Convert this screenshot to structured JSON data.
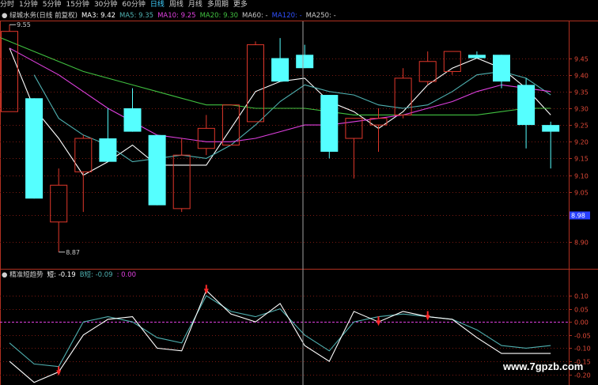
{
  "toolbar": {
    "items": [
      "分时",
      "1分钟",
      "5分钟",
      "15分钟",
      "30分钟",
      "60分钟",
      "日线",
      "周线",
      "月线",
      "多周期",
      "更多"
    ],
    "active_index": 6
  },
  "main_legend": {
    "title": "绿城水务(日线 前复权)",
    "ma": [
      {
        "label": "MA3: 9.42",
        "color": "#ffffff"
      },
      {
        "label": "MA5: 9.35",
        "color": "#4fb0b0"
      },
      {
        "label": "MA10: 9.25",
        "color": "#e040e0"
      },
      {
        "label": "MA20: 9.30",
        "color": "#40c040"
      },
      {
        "label": "MA60: -",
        "color": "#c8c8c8"
      },
      {
        "label": "MA120: -",
        "color": "#3050ff"
      },
      {
        "label": "MA250: -",
        "color": "#c8c8c8"
      }
    ]
  },
  "sub_legend": {
    "title": "精准短趋势",
    "items": [
      {
        "label": "短: -0.19",
        "color": "#ffffff"
      },
      {
        "label": "B短: -0.09",
        "color": "#4fb0b0"
      },
      {
        "label": ": 0.00",
        "color": "#e040e0"
      }
    ]
  },
  "price_axis": {
    "ticks": [
      "9.45",
      "9.40",
      "9.35",
      "9.30",
      "9.25",
      "9.20",
      "9.15",
      "9.10",
      "9.05",
      "8.98",
      "8.90"
    ],
    "tick_values": [
      9.45,
      9.4,
      9.35,
      9.3,
      9.25,
      9.2,
      9.15,
      9.1,
      9.05,
      8.98,
      8.9
    ],
    "highlight": "8.98"
  },
  "indicator_axis": {
    "ticks": [
      "0.10",
      "0.05",
      "0.00",
      "-0.05",
      "-0.10",
      "-0.15",
      "-0.20"
    ],
    "tick_values": [
      0.1,
      0.05,
      0.0,
      -0.05,
      -0.1,
      -0.15,
      -0.2
    ]
  },
  "annotations": {
    "high": "9.55",
    "low": "8.87"
  },
  "watermark": "www.7gpzb.com",
  "chart_data": {
    "type": "candlestick",
    "ylim": [
      8.82,
      9.56
    ],
    "candles": [
      {
        "o": 9.29,
        "h": 9.55,
        "l": 9.29,
        "c": 9.53
      },
      {
        "o": 9.33,
        "h": 9.33,
        "l": 9.03,
        "c": 9.03
      },
      {
        "o": 8.96,
        "h": 9.12,
        "l": 8.87,
        "c": 9.07
      },
      {
        "o": 9.11,
        "h": 9.22,
        "l": 8.99,
        "c": 9.21
      },
      {
        "o": 9.21,
        "h": 9.3,
        "l": 9.14,
        "c": 9.14
      },
      {
        "o": 9.3,
        "h": 9.36,
        "l": 9.23,
        "c": 9.23
      },
      {
        "o": 9.22,
        "h": 9.22,
        "l": 9.01,
        "c": 9.01
      },
      {
        "o": 9.0,
        "h": 9.21,
        "l": 8.99,
        "c": 9.16
      },
      {
        "o": 9.18,
        "h": 9.28,
        "l": 9.16,
        "c": 9.24
      },
      {
        "o": 9.19,
        "h": 9.31,
        "l": 9.19,
        "c": 9.31
      },
      {
        "o": 9.26,
        "h": 9.5,
        "l": 9.26,
        "c": 9.49
      },
      {
        "o": 9.45,
        "h": 9.51,
        "l": 9.38,
        "c": 9.38
      },
      {
        "o": 9.46,
        "h": 9.49,
        "l": 9.42,
        "c": 9.42
      },
      {
        "o": 9.34,
        "h": 9.34,
        "l": 9.15,
        "c": 9.17
      },
      {
        "o": 9.21,
        "h": 9.27,
        "l": 9.09,
        "c": 9.27
      },
      {
        "o": 9.25,
        "h": 9.3,
        "l": 9.17,
        "c": 9.27
      },
      {
        "o": 9.28,
        "h": 9.42,
        "l": 9.27,
        "c": 9.39
      },
      {
        "o": 9.38,
        "h": 9.47,
        "l": 9.37,
        "c": 9.44
      },
      {
        "o": 9.41,
        "h": 9.47,
        "l": 9.4,
        "c": 9.47
      },
      {
        "o": 9.46,
        "h": 9.47,
        "l": 9.45,
        "c": 9.45
      },
      {
        "o": 9.46,
        "h": 9.46,
        "l": 9.36,
        "c": 9.38
      },
      {
        "o": 9.37,
        "h": 9.39,
        "l": 9.18,
        "c": 9.25
      },
      {
        "o": 9.25,
        "h": 9.26,
        "l": 9.12,
        "c": 9.23
      }
    ],
    "series": [
      {
        "name": "MA3",
        "color": "#ffffff",
        "values": [
          9.48,
          9.3,
          9.21,
          9.1,
          9.14,
          9.19,
          9.13,
          9.13,
          9.13,
          9.24,
          9.35,
          9.38,
          9.39,
          9.32,
          9.29,
          9.24,
          9.29,
          9.37,
          9.42,
          9.45,
          9.42,
          9.36,
          9.28
        ]
      },
      {
        "name": "MA5",
        "color": "#4fb0b0",
        "values": [
          null,
          9.4,
          9.27,
          9.22,
          9.19,
          9.14,
          9.15,
          9.16,
          9.15,
          9.19,
          9.25,
          9.32,
          9.37,
          9.35,
          9.34,
          9.31,
          9.3,
          9.31,
          9.35,
          9.4,
          9.41,
          9.39,
          9.34
        ]
      },
      {
        "name": "MA10",
        "color": "#e040e0",
        "values": [
          9.48,
          9.44,
          9.4,
          9.35,
          9.3,
          9.26,
          9.22,
          9.21,
          9.2,
          9.2,
          9.21,
          9.23,
          9.25,
          9.25,
          9.26,
          9.27,
          9.28,
          9.3,
          9.32,
          9.35,
          9.37,
          9.36,
          9.35
        ]
      },
      {
        "name": "MA20",
        "color": "#40c040",
        "x_offset": -2,
        "values": [
          9.56,
          9.53,
          9.5,
          9.47,
          9.44,
          9.41,
          9.39,
          9.37,
          9.35,
          9.33,
          9.31,
          9.31,
          9.3,
          9.3,
          9.3,
          9.29,
          9.28,
          9.28,
          9.28,
          9.28,
          9.28,
          9.28,
          9.29,
          9.3,
          9.3
        ]
      }
    ],
    "indicator": {
      "ylim": [
        -0.24,
        0.16
      ],
      "series": [
        {
          "name": "短",
          "color": "#ffffff",
          "values": [
            -0.15,
            -0.23,
            -0.19,
            -0.05,
            0.01,
            0.02,
            -0.1,
            -0.11,
            0.12,
            0.03,
            0.0,
            0.07,
            -0.09,
            -0.15,
            0.04,
            0.0,
            0.04,
            0.02,
            0.01,
            -0.06,
            -0.12,
            -0.12,
            -0.12
          ]
        },
        {
          "name": "B短",
          "color": "#4fb0b0",
          "values": [
            -0.08,
            -0.16,
            -0.17,
            0.0,
            0.02,
            0.0,
            -0.06,
            -0.08,
            0.1,
            0.04,
            0.02,
            0.05,
            -0.05,
            -0.11,
            0.0,
            0.02,
            0.03,
            0.02,
            0.01,
            -0.03,
            -0.09,
            -0.1,
            -0.09
          ]
        }
      ],
      "zero_line_color": "#e040e0",
      "signal_markers": [
        2,
        8,
        15,
        17
      ]
    }
  }
}
